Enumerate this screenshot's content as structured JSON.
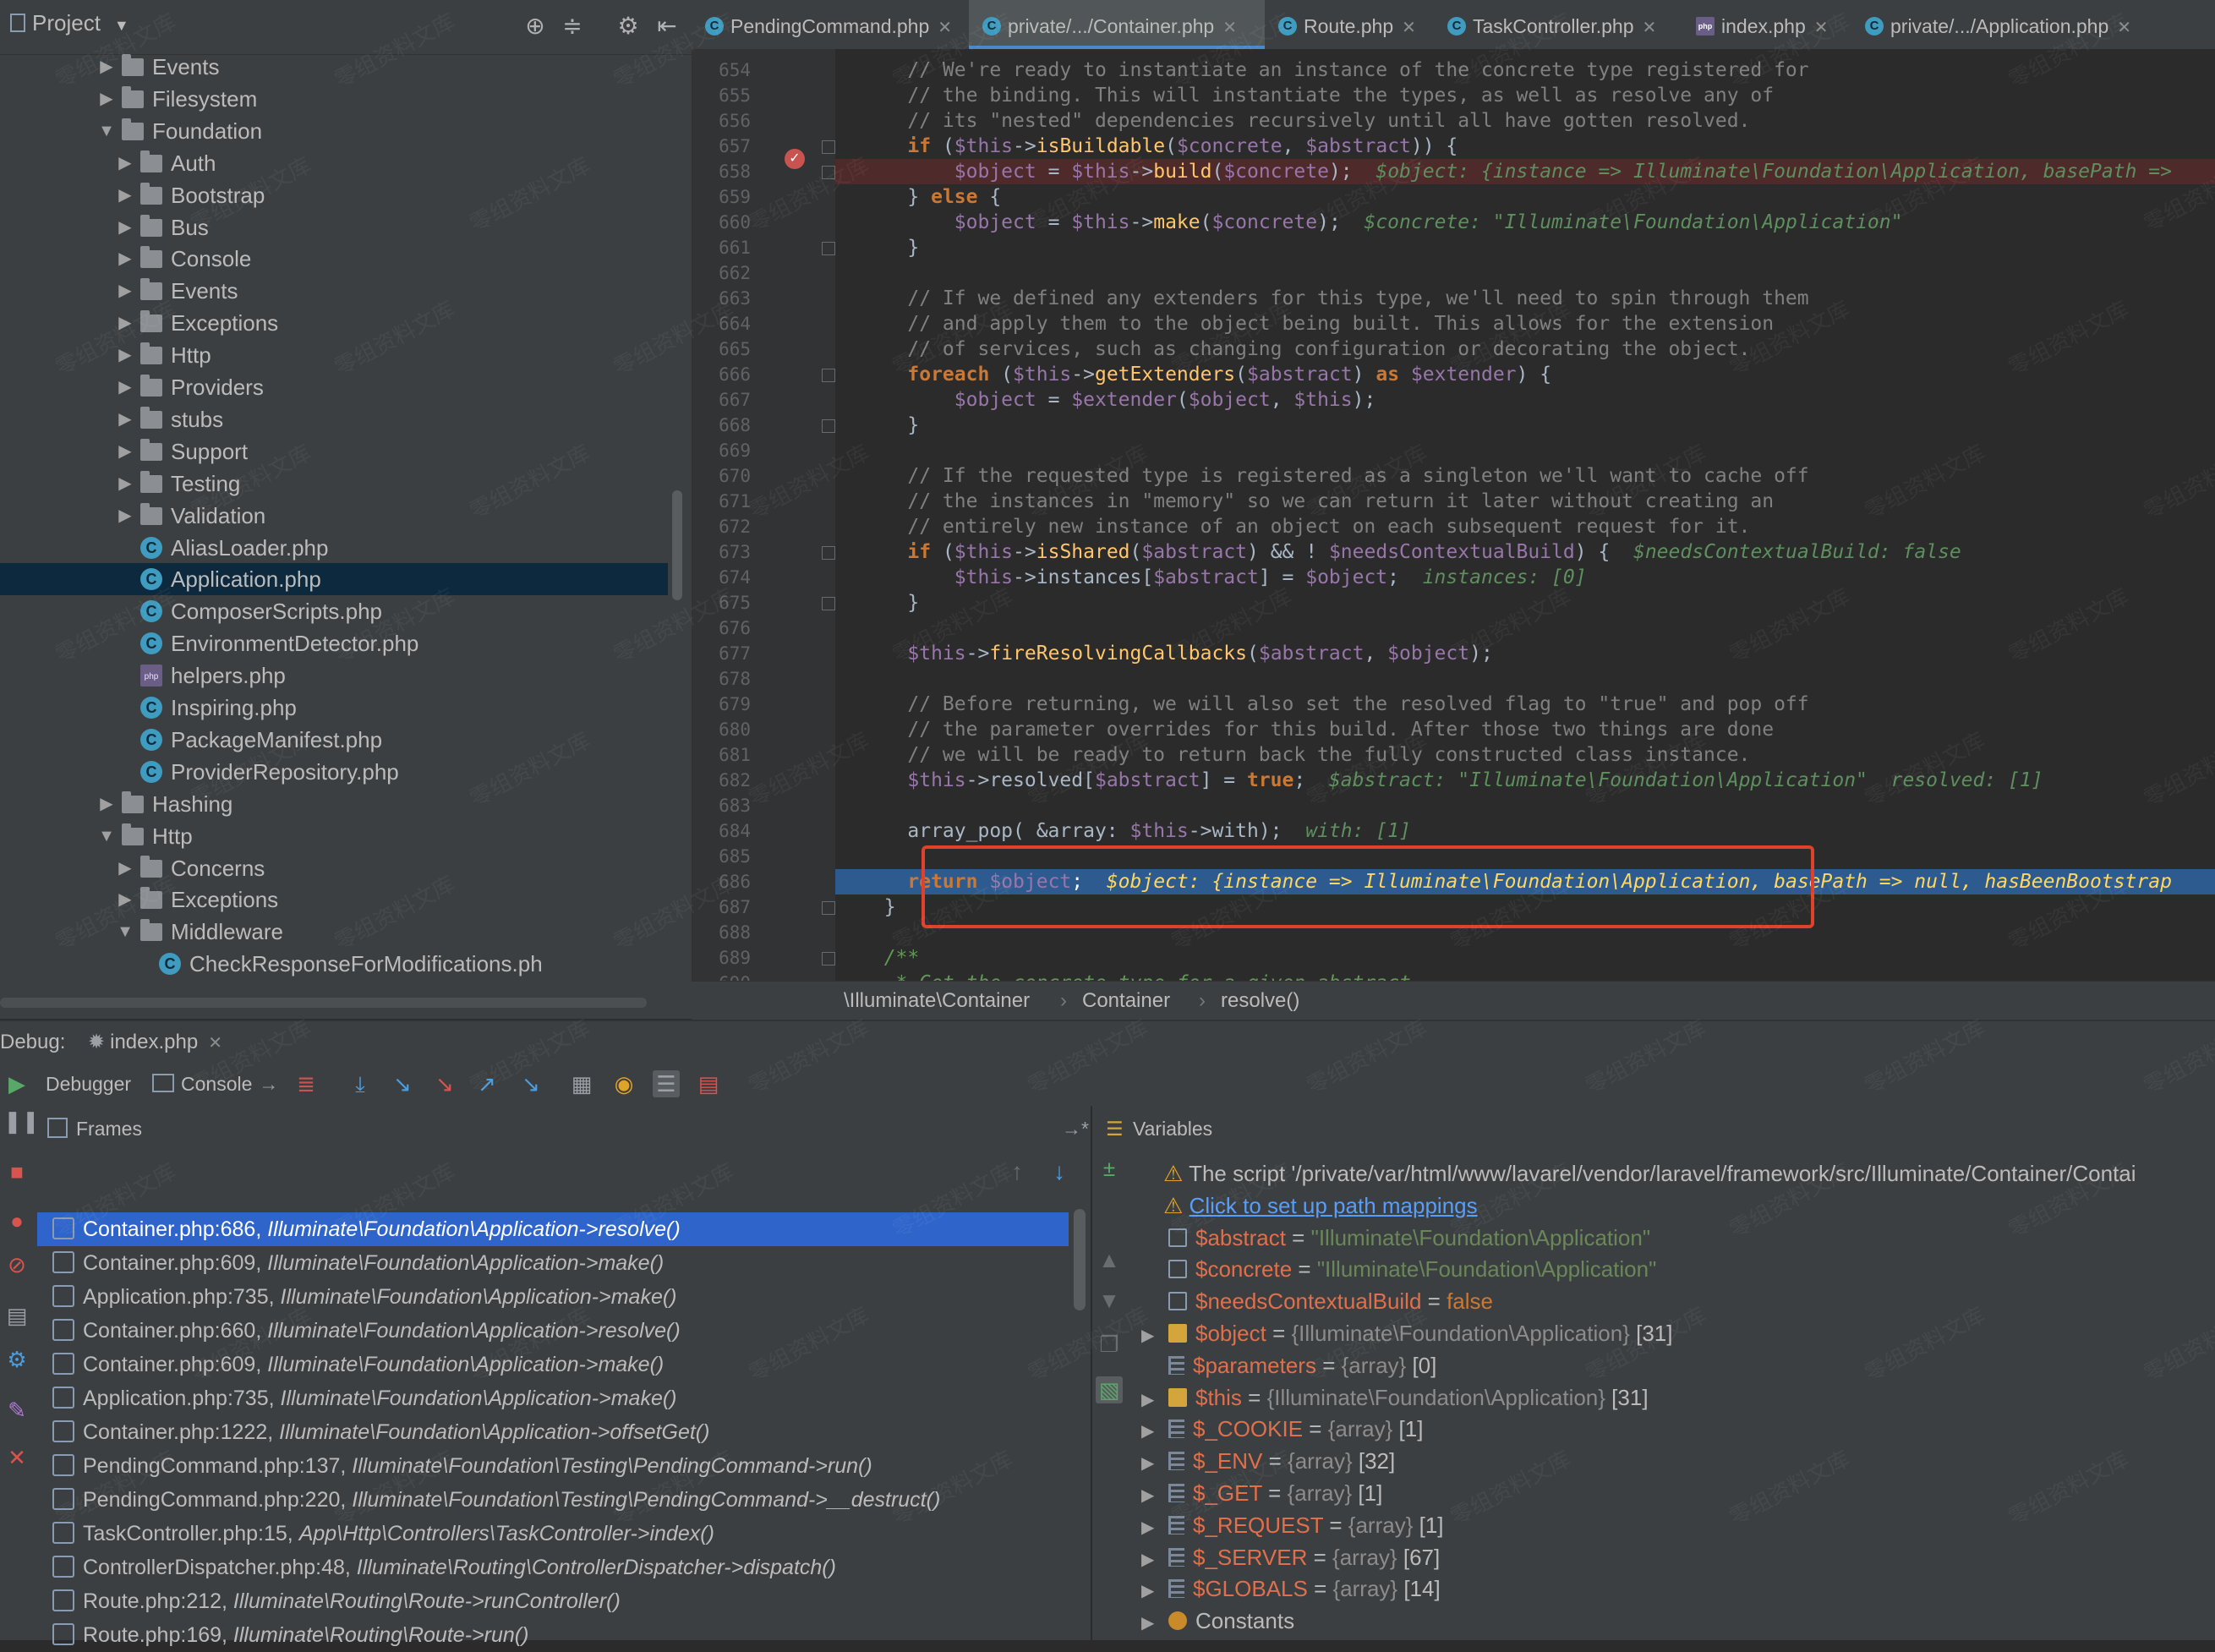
{
  "project": {
    "title": "Project",
    "tree": [
      {
        "label": "Events",
        "type": "folder",
        "depth": 1,
        "expanded": false
      },
      {
        "label": "Filesystem",
        "type": "folder",
        "depth": 1,
        "expanded": false
      },
      {
        "label": "Foundation",
        "type": "folder",
        "depth": 1,
        "expanded": true
      },
      {
        "label": "Auth",
        "type": "folder",
        "depth": 2,
        "expanded": false
      },
      {
        "label": "Bootstrap",
        "type": "folder",
        "depth": 2,
        "expanded": false
      },
      {
        "label": "Bus",
        "type": "folder",
        "depth": 2,
        "expanded": false
      },
      {
        "label": "Console",
        "type": "folder",
        "depth": 2,
        "expanded": false
      },
      {
        "label": "Events",
        "type": "folder",
        "depth": 2,
        "expanded": false
      },
      {
        "label": "Exceptions",
        "type": "folder",
        "depth": 2,
        "expanded": false
      },
      {
        "label": "Http",
        "type": "folder",
        "depth": 2,
        "expanded": false
      },
      {
        "label": "Providers",
        "type": "folder",
        "depth": 2,
        "expanded": false
      },
      {
        "label": "stubs",
        "type": "folder",
        "depth": 2,
        "expanded": false
      },
      {
        "label": "Support",
        "type": "folder",
        "depth": 2,
        "expanded": false
      },
      {
        "label": "Testing",
        "type": "folder",
        "depth": 2,
        "expanded": false
      },
      {
        "label": "Validation",
        "type": "folder",
        "depth": 2,
        "expanded": false
      },
      {
        "label": "AliasLoader.php",
        "type": "class",
        "depth": 2
      },
      {
        "label": "Application.php",
        "type": "class",
        "depth": 2,
        "selected": true
      },
      {
        "label": "ComposerScripts.php",
        "type": "class",
        "depth": 2
      },
      {
        "label": "EnvironmentDetector.php",
        "type": "class",
        "depth": 2
      },
      {
        "label": "helpers.php",
        "type": "php",
        "depth": 2
      },
      {
        "label": "Inspiring.php",
        "type": "class",
        "depth": 2
      },
      {
        "label": "PackageManifest.php",
        "type": "class",
        "depth": 2
      },
      {
        "label": "ProviderRepository.php",
        "type": "class",
        "depth": 2
      },
      {
        "label": "Hashing",
        "type": "folder",
        "depth": 1,
        "expanded": false
      },
      {
        "label": "Http",
        "type": "folder",
        "depth": 1,
        "expanded": true
      },
      {
        "label": "Concerns",
        "type": "folder",
        "depth": 2,
        "expanded": false
      },
      {
        "label": "Exceptions",
        "type": "folder",
        "depth": 2,
        "expanded": false
      },
      {
        "label": "Middleware",
        "type": "folder",
        "depth": 2,
        "expanded": true
      },
      {
        "label": "CheckResponseForModifications.ph",
        "type": "class",
        "depth": 3
      }
    ]
  },
  "tabs": [
    {
      "label": "PendingCommand.php",
      "icon": "class",
      "active": false
    },
    {
      "label": "private/.../Container.php",
      "icon": "class",
      "active": true
    },
    {
      "label": "Route.php",
      "icon": "class",
      "active": false
    },
    {
      "label": "TaskController.php",
      "icon": "class",
      "active": false
    },
    {
      "label": "index.php",
      "icon": "php",
      "active": false
    },
    {
      "label": "private/.../Application.php",
      "icon": "class",
      "active": false
    }
  ],
  "code": [
    {
      "n": "654",
      "text": "    // We're ready to instantiate an instance of the concrete type registered for",
      "kind": "comment"
    },
    {
      "n": "655",
      "text": "    // the binding. This will instantiate the types, as well as resolve any of",
      "kind": "comment"
    },
    {
      "n": "656",
      "text": "    // its \"nested\" dependencies recursively until all have gotten resolved.",
      "kind": "comment"
    },
    {
      "n": "657",
      "text": "    if ($this->isBuildable($concrete, $abstract)) {",
      "kind": "code"
    },
    {
      "n": "658",
      "text": "        $object = $this->build($concrete);",
      "inline": "  $object: {instance => Illuminate\\Foundation\\Application, basePath =>",
      "kind": "break"
    },
    {
      "n": "659",
      "text": "    } else {",
      "kind": "code"
    },
    {
      "n": "660",
      "text": "        $object = $this->make($concrete);",
      "inline": "  $concrete: \"Illuminate\\Foundation\\Application\"",
      "kind": "code"
    },
    {
      "n": "661",
      "text": "    }",
      "kind": "code"
    },
    {
      "n": "662",
      "text": "",
      "kind": "code"
    },
    {
      "n": "663",
      "text": "    // If we defined any extenders for this type, we'll need to spin through them",
      "kind": "comment"
    },
    {
      "n": "664",
      "text": "    // and apply them to the object being built. This allows for the extension",
      "kind": "comment"
    },
    {
      "n": "665",
      "text": "    // of services, such as changing configuration or decorating the object.",
      "kind": "comment"
    },
    {
      "n": "666",
      "text": "    foreach ($this->getExtenders($abstract) as $extender) {",
      "kind": "code"
    },
    {
      "n": "667",
      "text": "        $object = $extender($object, $this);",
      "kind": "code"
    },
    {
      "n": "668",
      "text": "    }",
      "kind": "code"
    },
    {
      "n": "669",
      "text": "",
      "kind": "code"
    },
    {
      "n": "670",
      "text": "    // If the requested type is registered as a singleton we'll want to cache off",
      "kind": "comment"
    },
    {
      "n": "671",
      "text": "    // the instances in \"memory\" so we can return it later without creating an",
      "kind": "comment"
    },
    {
      "n": "672",
      "text": "    // entirely new instance of an object on each subsequent request for it.",
      "kind": "comment"
    },
    {
      "n": "673",
      "text": "    if ($this->isShared($abstract) && ! $needsContextualBuild) {",
      "inline": "  $needsContextualBuild: false",
      "kind": "code"
    },
    {
      "n": "674",
      "text": "        $this->instances[$abstract] = $object;",
      "inline": "  instances: [0]",
      "kind": "code"
    },
    {
      "n": "675",
      "text": "    }",
      "kind": "code"
    },
    {
      "n": "676",
      "text": "",
      "kind": "code"
    },
    {
      "n": "677",
      "text": "    $this->fireResolvingCallbacks($abstract, $object);",
      "kind": "code"
    },
    {
      "n": "678",
      "text": "",
      "kind": "code"
    },
    {
      "n": "679",
      "text": "    // Before returning, we will also set the resolved flag to \"true\" and pop off",
      "kind": "comment"
    },
    {
      "n": "680",
      "text": "    // the parameter overrides for this build. After those two things are done",
      "kind": "comment"
    },
    {
      "n": "681",
      "text": "    // we will be ready to return back the fully constructed class instance.",
      "kind": "comment"
    },
    {
      "n": "682",
      "text": "    $this->resolved[$abstract] = true;",
      "inline": "  $abstract: \"Illuminate\\Foundation\\Application\"  resolved: [1]",
      "kind": "code"
    },
    {
      "n": "683",
      "text": "",
      "kind": "code"
    },
    {
      "n": "684",
      "text": "    array_pop( &array: $this->with);",
      "inline": "  with: [1]",
      "kind": "code"
    },
    {
      "n": "685",
      "text": "",
      "kind": "code"
    },
    {
      "n": "686",
      "text": "    return $object;",
      "inline": "  $object: {instance => Illuminate\\Foundation\\Application, basePath => null, hasBeenBootstrap",
      "kind": "exec"
    },
    {
      "n": "687",
      "text": "  }",
      "kind": "code"
    },
    {
      "n": "688",
      "text": "",
      "kind": "code"
    },
    {
      "n": "689",
      "text": "  /**",
      "kind": "doc"
    },
    {
      "n": "690",
      "text": "   * Get the concrete type for a given abstract.",
      "kind": "doc"
    }
  ],
  "breadcrumb": [
    "\\Illuminate\\Container",
    "Container",
    "resolve()"
  ],
  "debug": {
    "label": "Debug:",
    "session": "index.php",
    "tabs": {
      "debugger": "Debugger",
      "console": "Console"
    },
    "frames_title": "Frames",
    "variables_title": "Variables",
    "frames": [
      {
        "file": "Container.php:686,",
        "method": "Illuminate\\Foundation\\Application->resolve()",
        "selected": true
      },
      {
        "file": "Container.php:609,",
        "method": "Illuminate\\Foundation\\Application->make()"
      },
      {
        "file": "Application.php:735,",
        "method": "Illuminate\\Foundation\\Application->make()"
      },
      {
        "file": "Container.php:660,",
        "method": "Illuminate\\Foundation\\Application->resolve()"
      },
      {
        "file": "Container.php:609,",
        "method": "Illuminate\\Foundation\\Application->make()"
      },
      {
        "file": "Application.php:735,",
        "method": "Illuminate\\Foundation\\Application->make()"
      },
      {
        "file": "Container.php:1222,",
        "method": "Illuminate\\Foundation\\Application->offsetGet()"
      },
      {
        "file": "PendingCommand.php:137,",
        "method": "Illuminate\\Foundation\\Testing\\PendingCommand->run()"
      },
      {
        "file": "PendingCommand.php:220,",
        "method": "Illuminate\\Foundation\\Testing\\PendingCommand->__destruct()"
      },
      {
        "file": "TaskController.php:15,",
        "method": "App\\Http\\Controllers\\TaskController->index()"
      },
      {
        "file": "ControllerDispatcher.php:48,",
        "method": "Illuminate\\Routing\\ControllerDispatcher->dispatch()"
      },
      {
        "file": "Route.php:212,",
        "method": "Illuminate\\Routing\\Route->runController()"
      },
      {
        "file": "Route.php:169,",
        "method": "Illuminate\\Routing\\Route->run()"
      }
    ],
    "variables": [
      {
        "kind": "warn",
        "text": "The script '/private/var/html/www/lavarel/vendor/laravel/framework/src/Illuminate/Container/Contai"
      },
      {
        "kind": "link",
        "text": "Click to set up path mappings"
      },
      {
        "kind": "var",
        "icon": "prim",
        "name": "$abstract",
        "value": "\"Illuminate\\Foundation\\Application\"",
        "vtype": "str"
      },
      {
        "kind": "var",
        "icon": "prim",
        "name": "$concrete",
        "value": "\"Illuminate\\Foundation\\Application\"",
        "vtype": "str"
      },
      {
        "kind": "var",
        "icon": "prim",
        "name": "$needsContextualBuild",
        "value": "false",
        "vtype": "kw"
      },
      {
        "kind": "var",
        "icon": "obj",
        "name": "$object",
        "value": "{Illuminate\\Foundation\\Application} [31]",
        "vtype": "obj",
        "expand": true
      },
      {
        "kind": "var",
        "icon": "arr",
        "name": "$parameters",
        "value": "{array} [0]",
        "vtype": "obj"
      },
      {
        "kind": "var",
        "icon": "obj",
        "name": "$this",
        "value": "{Illuminate\\Foundation\\Application} [31]",
        "vtype": "obj",
        "expand": true
      },
      {
        "kind": "var",
        "icon": "arr",
        "name": "$_COOKIE",
        "value": "{array} [1]",
        "vtype": "obj",
        "expand": true
      },
      {
        "kind": "var",
        "icon": "arr",
        "name": "$_ENV",
        "value": "{array} [32]",
        "vtype": "obj",
        "expand": true
      },
      {
        "kind": "var",
        "icon": "arr",
        "name": "$_GET",
        "value": "{array} [1]",
        "vtype": "obj",
        "expand": true
      },
      {
        "kind": "var",
        "icon": "arr",
        "name": "$_REQUEST",
        "value": "{array} [1]",
        "vtype": "obj",
        "expand": true
      },
      {
        "kind": "var",
        "icon": "arr",
        "name": "$_SERVER",
        "value": "{array} [67]",
        "vtype": "obj",
        "expand": true
      },
      {
        "kind": "var",
        "icon": "arr",
        "name": "$GLOBALS",
        "value": "{array} [14]",
        "vtype": "obj",
        "expand": true
      },
      {
        "kind": "const",
        "icon": "const",
        "name": "Constants",
        "value": "",
        "vtype": "obj",
        "expand": true
      }
    ]
  },
  "watermark": "零组资料文库"
}
